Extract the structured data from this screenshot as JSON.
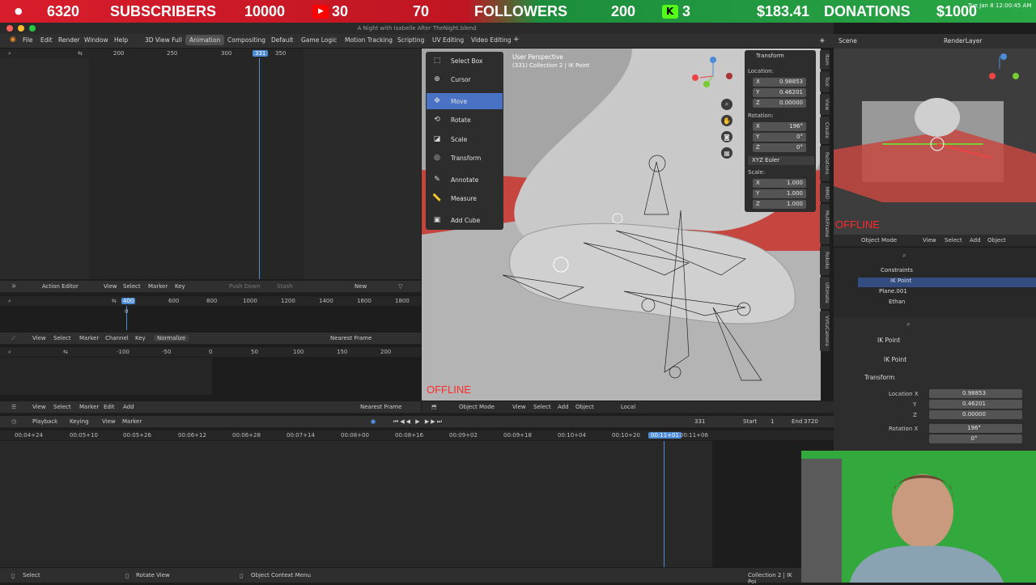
{
  "stream_bar": {
    "subscribers_count": "6320",
    "subscribers_label": "SUBSCRIBERS",
    "subscribers_goal": "10000",
    "youtube_count": "30",
    "followers_count": "70",
    "followers_label": "FOLLOWERS",
    "followers_goal": "200",
    "kick_count": "3",
    "donations_amount": "$183.41",
    "donations_label": "DONATIONS",
    "donations_goal": "$1000",
    "clock": "Tue Jan 8  12:00:45 AM"
  },
  "app": {
    "name": "Blender",
    "window_menu": "Window",
    "file_title": "A Night with Isabelle After TheNight.blend"
  },
  "top_menu": [
    "File",
    "Edit",
    "Render",
    "Window",
    "Help"
  ],
  "workspaces": [
    "3D View Full",
    "Animation",
    "Compositing",
    "Default",
    "Game Logic",
    "Motion Tracking",
    "Scripting",
    "UV Editing",
    "Video Editing"
  ],
  "active_workspace": "Animation",
  "scene": {
    "label": "Scene",
    "view_layer": "RenderLayer"
  },
  "top_ruler": {
    "ticks": [
      "200",
      "250",
      "300",
      "350"
    ],
    "current": "331"
  },
  "action_editor": {
    "mode": "Action Editor",
    "menus": [
      "View",
      "Select",
      "Marker",
      "Key"
    ],
    "push_down": "Push Down",
    "stash": "Stash",
    "new_label": "New",
    "ticks": [
      "400",
      "600",
      "800",
      "1000",
      "1200",
      "1400",
      "1600",
      "1800"
    ],
    "marker_value": "0"
  },
  "graph_editor": {
    "menus": [
      "View",
      "Select",
      "Marker",
      "Channel",
      "Key"
    ],
    "normalize": "Normalize",
    "interp": "Nearest Frame",
    "ticks": [
      "-100",
      "-50",
      "0",
      "50",
      "100",
      "150",
      "200"
    ]
  },
  "nla_header": {
    "menus": [
      "View",
      "Select",
      "Marker",
      "Edit",
      "Add"
    ],
    "interp": "Nearest Frame"
  },
  "timeline": {
    "menus": [
      "Playback",
      "Keying",
      "View",
      "Marker"
    ],
    "current_frame": "331",
    "start_label": "Start",
    "start_value": "1",
    "end_label": "End",
    "end_value": "3720",
    "ticks": [
      "00:04+24",
      "00:05+10",
      "00:05+26",
      "00:06+12",
      "00:06+28",
      "00:07+14",
      "00:08+00",
      "00:08+16",
      "00:09+02",
      "00:09+18",
      "00:10+04",
      "00:10+20",
      "00:11+06"
    ],
    "current_time": "00:11+01"
  },
  "viewport": {
    "view_name": "User Perspective",
    "collection": "(331) Collection 2 | IK Point",
    "offline_label": "OFFLINE",
    "mode": "Object Mode",
    "menus": [
      "View",
      "Select",
      "Add",
      "Object"
    ],
    "orientation": "Local"
  },
  "toolbar": [
    {
      "label": "Select Box",
      "icon": "select-box-icon"
    },
    {
      "label": "Cursor",
      "icon": "cursor-icon"
    },
    {
      "label": "Move",
      "icon": "move-icon"
    },
    {
      "label": "Rotate",
      "icon": "rotate-icon"
    },
    {
      "label": "Scale",
      "icon": "scale-icon"
    },
    {
      "label": "Transform",
      "icon": "transform-icon"
    },
    {
      "label": "Annotate",
      "icon": "annotate-icon"
    },
    {
      "label": "Measure",
      "icon": "measure-icon"
    },
    {
      "label": "Add Cube",
      "icon": "add-cube-icon"
    }
  ],
  "active_tool": "Move",
  "transform_panel": {
    "title": "Transform",
    "location_label": "Location:",
    "loc": {
      "x": "0.98853",
      "y": "0.46201",
      "z": "0.00000"
    },
    "rotation_label": "Rotation:",
    "rot": {
      "x": "196°",
      "y": "0°",
      "z": "0°"
    },
    "rotation_mode": "XYZ Euler",
    "scale_label": "Scale:",
    "scale": {
      "x": "1.000",
      "y": "1.000",
      "z": "1.000"
    }
  },
  "side_tabs": [
    "Item",
    "Tool",
    "View",
    "Create",
    "Relations",
    "MMD",
    "MultiFrame",
    "Rokoko",
    "Ultimate",
    "VirtuCamera"
  ],
  "secondary_view": {
    "offline_label": "OFFLINE",
    "mode": "Object Mode",
    "menus": [
      "View",
      "Select",
      "Add",
      "Object"
    ]
  },
  "outliner": {
    "rows": [
      "Constraints",
      "IK Point",
      "Plane.001",
      "Ethan"
    ]
  },
  "properties": {
    "object_name": "IK Point",
    "sub_name": "IK Point",
    "section": "Transform",
    "location_x_label": "Location X",
    "location_x": "0.98853",
    "y_label": "Y",
    "location_y": "0.46201",
    "z_label": "Z",
    "location_z": "0.00000",
    "rotation_x_label": "Rotation X",
    "rotation_x": "196°",
    "rotation_y": "0°"
  },
  "status_bar": {
    "select": "Select",
    "rotate_view": "Rotate View",
    "context_menu": "Object Context Menu",
    "right_info": "Collection 2 | IK Poi"
  },
  "colors": {
    "accent": "#4a72c4",
    "playhead": "#4d8cd8",
    "offline": "#ff2a2a",
    "ground": "#c6463f"
  }
}
